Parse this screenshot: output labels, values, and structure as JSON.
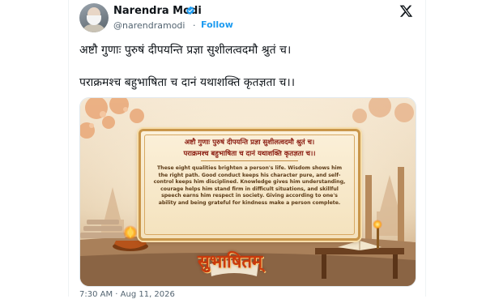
{
  "author": {
    "name": "Narendra Modi",
    "handle": "@narendramodi",
    "separator": "·",
    "follow_label": "Follow",
    "verified_color": "#1d9bf0"
  },
  "icons": {
    "verified": "verified-badge-icon",
    "platform": "x-logo-icon"
  },
  "post": {
    "line1": "अष्टौ गुणाः पुरुषं दीपयन्ति प्रज्ञा सुशीलत्वदमौ श्रुतं च।",
    "line2": "पराक्रमश्च बहुभाषिता च दानं यथाशक्ति कृतज्ञता च।।"
  },
  "media": {
    "sanskrit_line1": "अष्टौ गुणाः पुरुषं दीपयन्ति प्रज्ञा सुशीलत्वदमौ श्रुतं च।",
    "sanskrit_line2": "पराक्रमश्च बहुभाषिता च दानं यथाशक्ति कृतज्ञता च।।",
    "meaning": "These eight qualities brighten a person's life. Wisdom shows him the right path. Good conduct keeps his character pure, and self-control keeps him disciplined. Knowledge gives him understanding, courage helps him stand firm in difficult situations, and skillful speech earns him respect in society. Giving according to one's ability and being grateful for kindness make a person complete.",
    "brand": "सुभाषितम्"
  },
  "meta": {
    "timestamp": "7:30 AM · Aug 11, 2026"
  }
}
